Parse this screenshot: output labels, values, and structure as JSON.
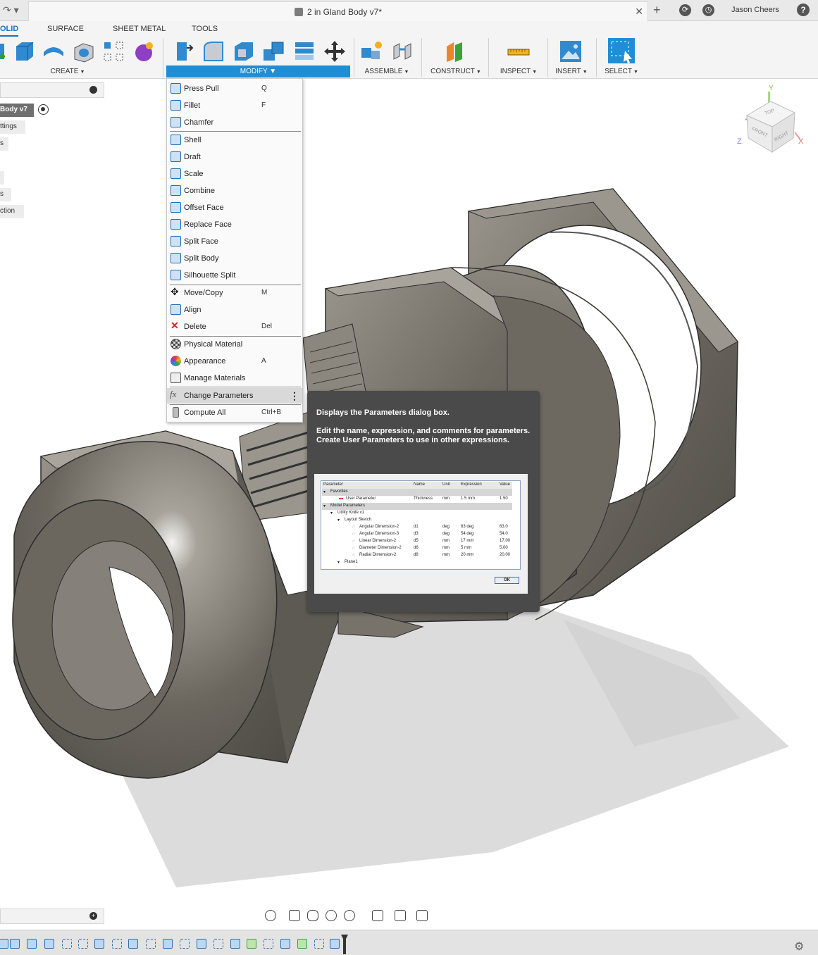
{
  "window": {
    "document_title": "2 in Gland Body v7*",
    "user_name": "Jason Cheers",
    "help_label": "?"
  },
  "workspace_tabs": [
    {
      "label": "OLID",
      "active": true
    },
    {
      "label": "SURFACE",
      "active": false
    },
    {
      "label": "SHEET METAL",
      "active": false
    },
    {
      "label": "TOOLS",
      "active": false
    }
  ],
  "ribbon_groups": {
    "create": "CREATE",
    "modify": "MODIFY",
    "assemble": "ASSEMBLE",
    "construct": "CONSTRUCT",
    "inspect": "INSPECT",
    "insert": "INSERT",
    "select": "SELECT"
  },
  "browser": {
    "items": [
      {
        "label": "Body v7"
      },
      {
        "label": "ttings"
      },
      {
        "label": "s"
      },
      {
        "label": ""
      },
      {
        "label": "s"
      },
      {
        "label": "ction"
      }
    ]
  },
  "modify_menu": {
    "items": [
      {
        "label": "Press Pull",
        "shortcut": "Q",
        "icon": "press-pull-icon"
      },
      {
        "label": "Fillet",
        "shortcut": "F",
        "icon": "fillet-icon"
      },
      {
        "label": "Chamfer",
        "shortcut": "",
        "icon": "chamfer-icon"
      },
      {
        "label": "Shell",
        "shortcut": "",
        "icon": "shell-icon"
      },
      {
        "label": "Draft",
        "shortcut": "",
        "icon": "draft-icon"
      },
      {
        "label": "Scale",
        "shortcut": "",
        "icon": "scale-icon"
      },
      {
        "label": "Combine",
        "shortcut": "",
        "icon": "combine-icon"
      },
      {
        "label": "Offset Face",
        "shortcut": "",
        "icon": "offset-face-icon"
      },
      {
        "label": "Replace Face",
        "shortcut": "",
        "icon": "replace-face-icon"
      },
      {
        "label": "Split Face",
        "shortcut": "",
        "icon": "split-face-icon"
      },
      {
        "label": "Split Body",
        "shortcut": "",
        "icon": "split-body-icon"
      },
      {
        "label": "Silhouette Split",
        "shortcut": "",
        "icon": "silhouette-split-icon"
      },
      {
        "label": "Move/Copy",
        "shortcut": "M",
        "icon": "move-copy-icon"
      },
      {
        "label": "Align",
        "shortcut": "",
        "icon": "align-icon"
      },
      {
        "label": "Delete",
        "shortcut": "Del",
        "icon": "delete-icon"
      },
      {
        "label": "Physical Material",
        "shortcut": "",
        "icon": "physical-material-icon"
      },
      {
        "label": "Appearance",
        "shortcut": "A",
        "icon": "appearance-icon"
      },
      {
        "label": "Manage Materials",
        "shortcut": "",
        "icon": "manage-materials-icon"
      },
      {
        "label": "Change Parameters",
        "shortcut": "",
        "icon": "change-parameters-icon",
        "highlighted": true
      },
      {
        "label": "Compute All",
        "shortcut": "Ctrl+B",
        "icon": "compute-all-icon"
      }
    ]
  },
  "tooltip": {
    "title": "Displays the Parameters dialog box.",
    "body": "Edit the name, expression, and comments for parameters. Create User Parameters to use in other expressions.",
    "preview": {
      "columns": [
        "Parameter",
        "Name",
        "Unit",
        "Expression",
        "Value"
      ],
      "rows": [
        {
          "parameter": "Favorites",
          "name": "",
          "unit": "",
          "expression": "",
          "value": ""
        },
        {
          "parameter": "User Parameter",
          "name": "Thickness",
          "unit": "mm",
          "expression": "1.5 mm",
          "value": "1.50"
        },
        {
          "parameter": "Model Parameters",
          "name": "",
          "unit": "",
          "expression": "",
          "value": ""
        },
        {
          "parameter": "Utility Knife v1",
          "name": "",
          "unit": "",
          "expression": "",
          "value": ""
        },
        {
          "parameter": "Layout Sketch",
          "name": "",
          "unit": "",
          "expression": "",
          "value": ""
        },
        {
          "parameter": "Angular Dimension-2",
          "name": "d1",
          "unit": "deg",
          "expression": "63 deg",
          "value": "63.0"
        },
        {
          "parameter": "Angular Dimension-3",
          "name": "d3",
          "unit": "deg",
          "expression": "54 deg",
          "value": "54.0"
        },
        {
          "parameter": "Linear Dimension-2",
          "name": "d5",
          "unit": "mm",
          "expression": "17 mm",
          "value": "17.00"
        },
        {
          "parameter": "Diameter Dimension-2",
          "name": "d6",
          "unit": "mm",
          "expression": "5 mm",
          "value": "5.00"
        },
        {
          "parameter": "Radial Dimension-2",
          "name": "d8",
          "unit": "mm",
          "expression": "20 mm",
          "value": "20.00"
        },
        {
          "parameter": "Plane1",
          "name": "",
          "unit": "",
          "expression": "",
          "value": ""
        }
      ],
      "ok_label": "OK"
    }
  },
  "viewcube": {
    "top": "TOP",
    "front": "FRONT",
    "right": "RIGHT",
    "axis_x": "X",
    "axis_y": "Y",
    "axis_z": "Z"
  },
  "colors": {
    "accent": "#1e8fd6",
    "model": "#6e6a62",
    "tooltip_bg": "#4a4a4a"
  }
}
